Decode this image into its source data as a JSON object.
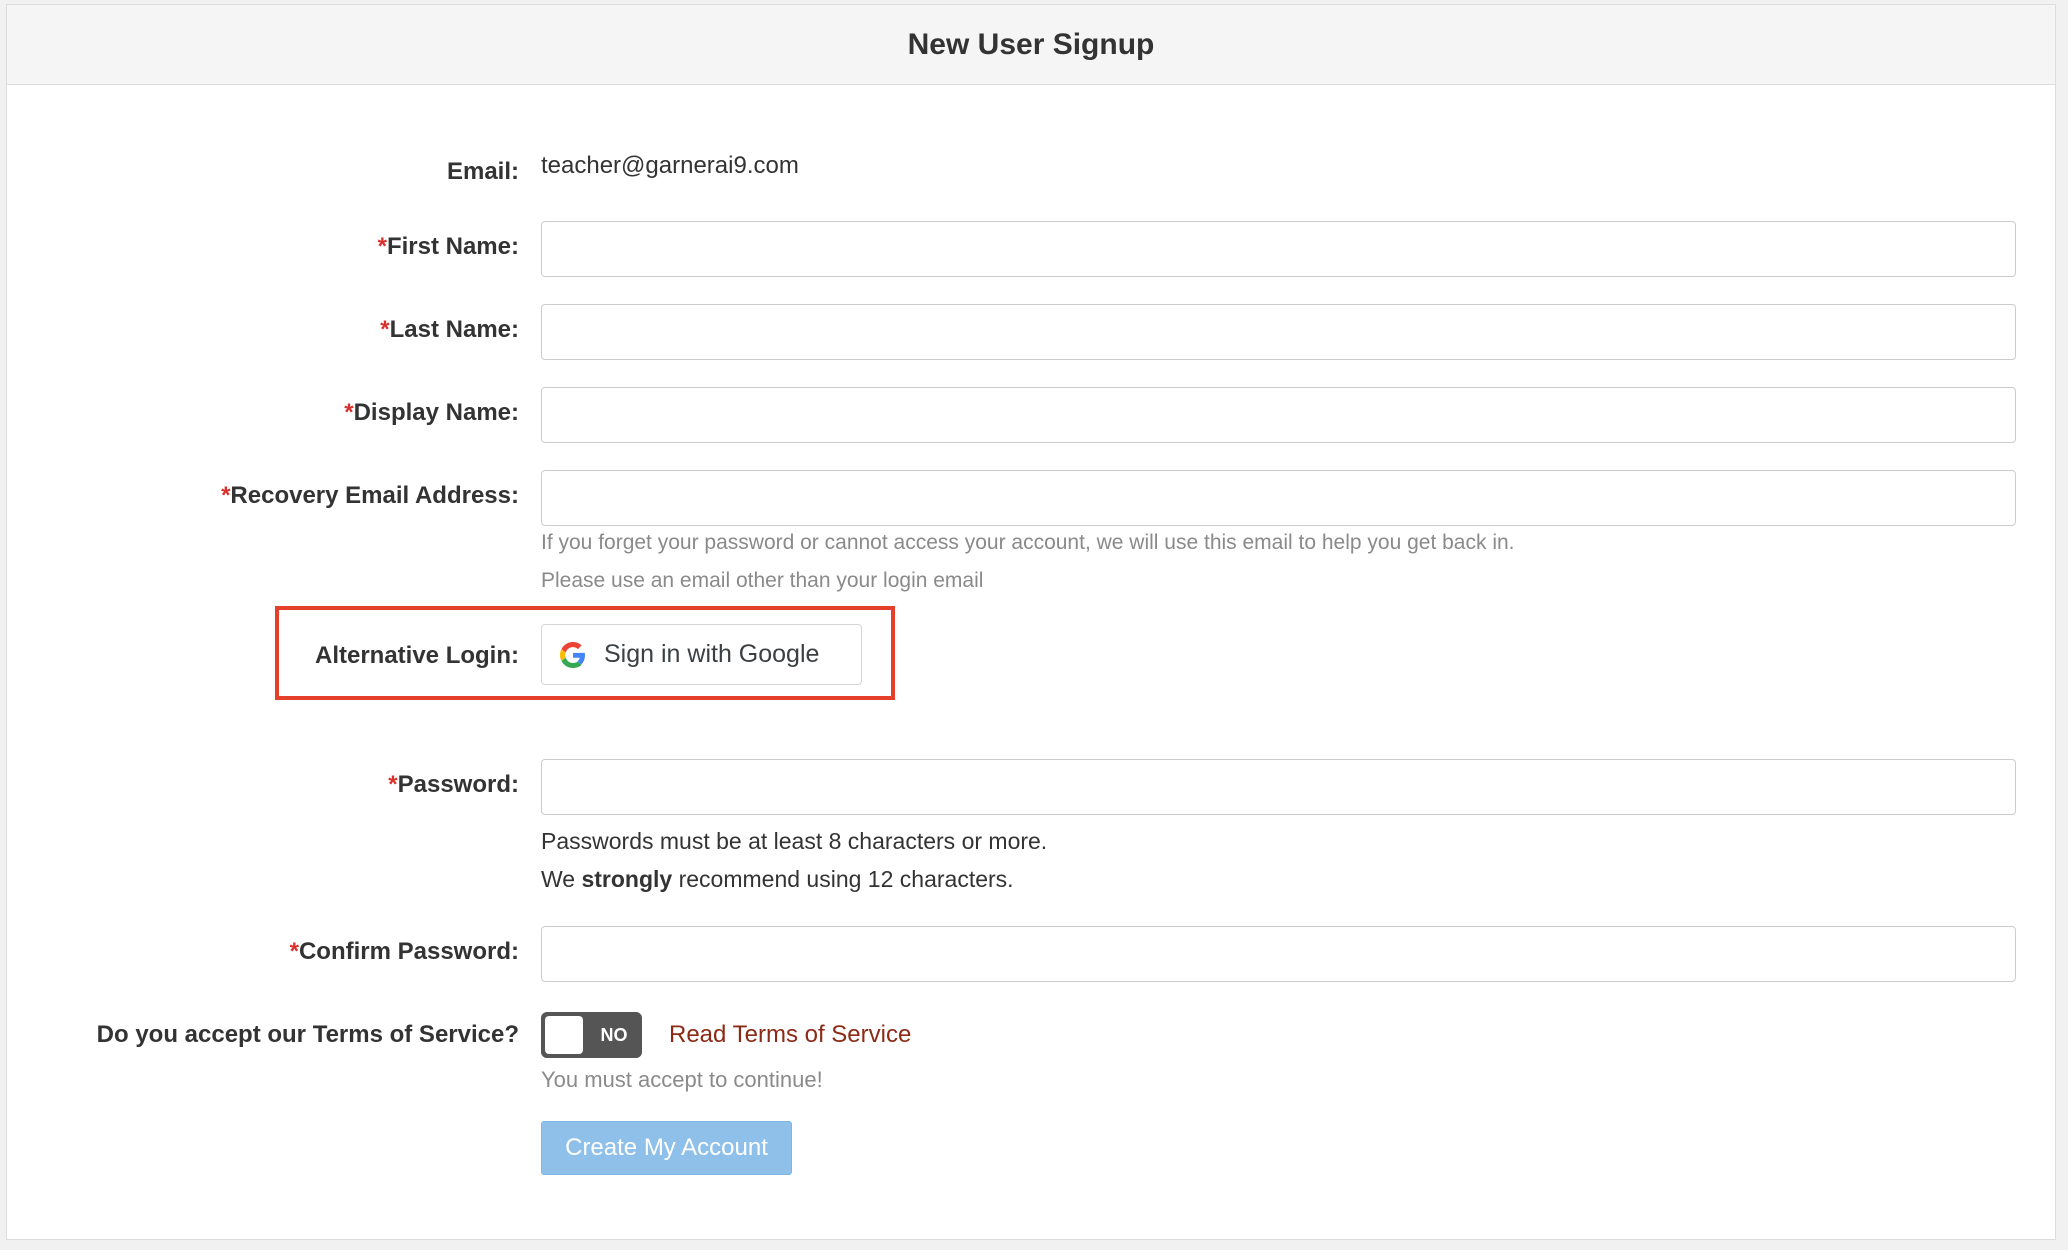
{
  "header": {
    "title": "New User Signup"
  },
  "form": {
    "email_label": "Email:",
    "email_value": "teacher@garnerai9.com",
    "required_mark": "*",
    "first_name_label": "First Name:",
    "first_name_value": "",
    "last_name_label": "Last Name:",
    "last_name_value": "",
    "display_name_label": "Display Name:",
    "display_name_value": "",
    "recovery_email_label": "Recovery Email Address:",
    "recovery_email_value": "",
    "recovery_help_1": "If you forget your password or cannot access your account, we will use this email to help you get back in.",
    "recovery_help_2": "Please use an email other than your login email",
    "alt_login_label": "Alternative Login:",
    "google_button_label": "Sign in with Google",
    "password_label": "Password:",
    "password_value": "",
    "password_note_1": "Passwords must be at least 8 characters or more.",
    "password_note_2_pre": "We",
    "password_note_2_bold": "strongly",
    "password_note_2_post": "recommend using 12 characters.",
    "confirm_password_label": "Confirm Password:",
    "confirm_password_value": "",
    "tos_label": "Do you accept our Terms of Service?",
    "tos_toggle_text": "NO",
    "tos_link": "Read Terms of Service",
    "tos_help": "You must accept to continue!",
    "create_button_label": "Create My Account"
  },
  "icons": {
    "google": "google-g-icon"
  },
  "colors": {
    "required": "#d9302c",
    "highlight": "#e5402b",
    "tos_link": "#8b2a16",
    "create_button": "#8ec0ea",
    "toggle": "#555555"
  }
}
